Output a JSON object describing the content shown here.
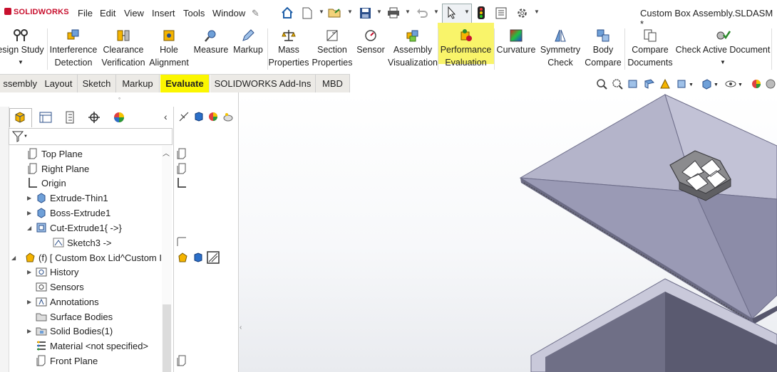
{
  "titlebar": {
    "logo": "SOLIDWORKS",
    "menu": [
      "File",
      "Edit",
      "View",
      "Insert",
      "Tools",
      "Window"
    ],
    "document_title": "Custom Box Assembly.SLDASM *"
  },
  "ribbon": {
    "design_study": "esign Study",
    "interference": "Interference",
    "interference2": "Detection",
    "clearance": "Clearance",
    "clearance2": "Verification",
    "hole": "Hole",
    "hole2": "Alignment",
    "measure": "Measure",
    "markup": "Markup",
    "mass": "Mass",
    "mass2": "Properties",
    "section": "Section",
    "section2": "Properties",
    "sensor": "Sensor",
    "assyvis": "Assembly",
    "assyvis2": "Visualization",
    "perf": "Performance",
    "perf2": "Evaluation",
    "curvature": "Curvature",
    "symmetry": "Symmetry",
    "symmetry2": "Check",
    "bodycompare": "Body",
    "bodycompare2": "Compare",
    "compare": "Compare",
    "compare2": "Documents",
    "checkactive": "Check Active Document"
  },
  "tabs": [
    "ssembly",
    "Layout",
    "Sketch",
    "Markup",
    "Evaluate",
    "SOLIDWORKS Add-Ins",
    "MBD"
  ],
  "tree": {
    "top_plane": "Top Plane",
    "right_plane": "Right Plane",
    "origin": "Origin",
    "extrude_thin": "Extrude-Thin1",
    "boss_extrude": "Boss-Extrude1",
    "cut_extrude": "Cut-Extrude1{ ->}",
    "sketch3": "Sketch3 ->",
    "lid": "(f) [ Custom Box Lid^Custom I",
    "history": "History",
    "sensors": "Sensors",
    "annotations": "Annotations",
    "surface_bodies": "Surface Bodies",
    "solid_bodies": "Solid Bodies(1)",
    "material": "Material <not specified>",
    "front_plane": "Front Plane"
  },
  "colors": {
    "highlight": "#f9f46a",
    "tab_active": "#fbf600",
    "model_face": "#9696b4",
    "model_face_dark": "#7a7a98",
    "brand_red": "#c8102e"
  }
}
